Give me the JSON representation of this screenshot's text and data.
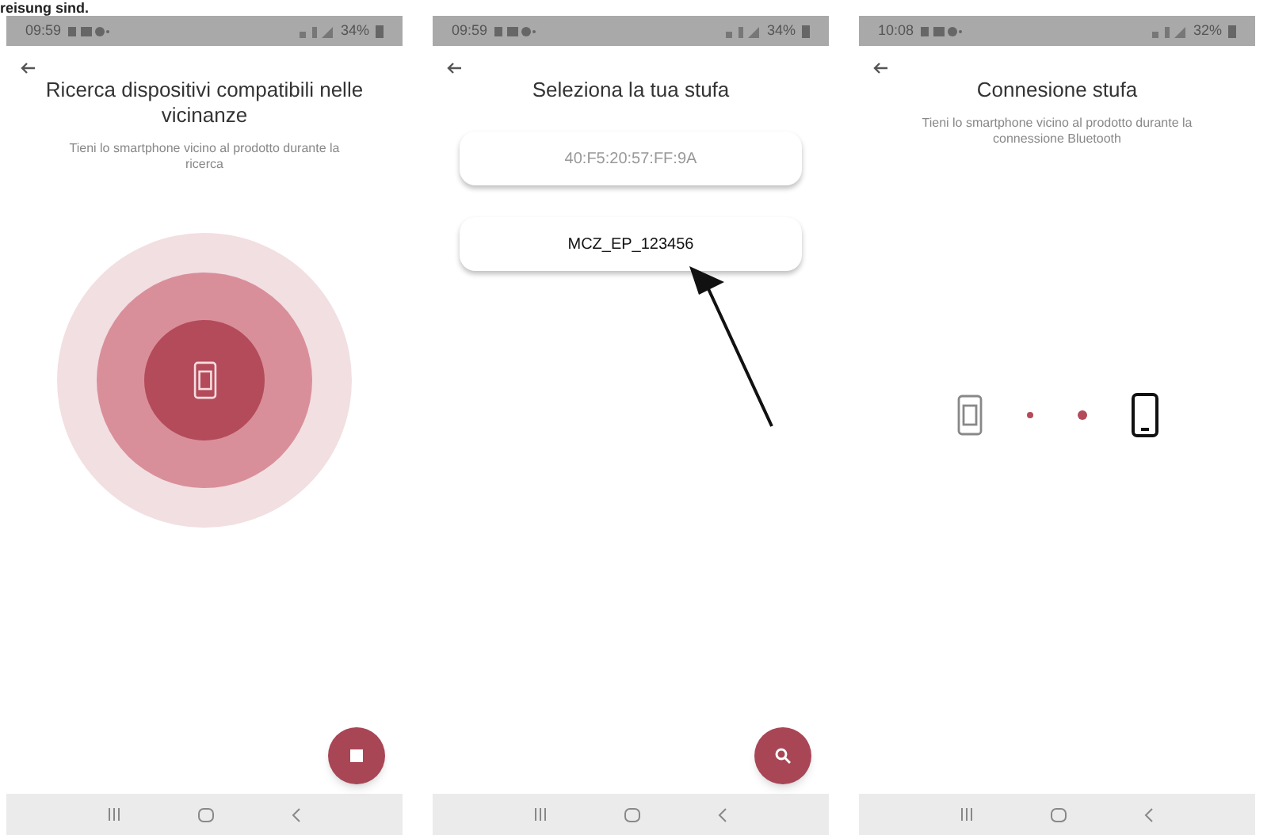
{
  "caption": "reisung sind.",
  "screens": [
    {
      "kind": "search",
      "status_bar": {
        "time": "09:59",
        "battery": "34%"
      },
      "title": "Ricerca dispositivi compatibili nelle vicinanze",
      "subtitle": "Tieni lo smartphone vicino al prodotto durante la ricerca"
    },
    {
      "kind": "select",
      "status_bar": {
        "time": "09:59",
        "battery": "34%"
      },
      "title": "Seleziona la tua stufa",
      "devices": [
        {
          "label": "40:F5:20:57:FF:9A",
          "highlighted": false
        },
        {
          "label": "MCZ_EP_123456",
          "highlighted": true
        }
      ]
    },
    {
      "kind": "connect",
      "status_bar": {
        "time": "10:08",
        "battery": "32%"
      },
      "title": "Connesione stufa",
      "subtitle": "Tieni lo smartphone vicino al prodotto durante la connessione Bluetooth"
    }
  ]
}
